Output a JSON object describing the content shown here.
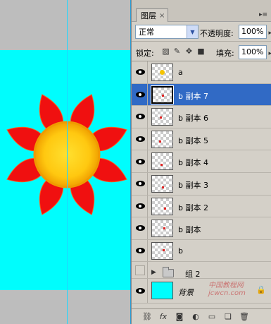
{
  "panel": {
    "tab_label": "图层",
    "tab_close": "×",
    "menu_icon": "▸≡"
  },
  "blend": {
    "mode": "正常",
    "opacity_label": "不透明度:",
    "opacity_value": "100%"
  },
  "lock": {
    "label": "锁定:",
    "fill_label": "填充:",
    "fill_value": "100%",
    "icons": [
      "lock-transparency-icon",
      "lock-pixels-icon",
      "lock-position-icon",
      "lock-all-icon"
    ]
  },
  "layers": [
    {
      "name": "a",
      "visible": true,
      "selected": false,
      "thumb": "sun"
    },
    {
      "name": "b 副本 7",
      "visible": true,
      "selected": true,
      "thumb": "petal"
    },
    {
      "name": "b 副本 6",
      "visible": true,
      "selected": false,
      "thumb": "petal"
    },
    {
      "name": "b 副本 5",
      "visible": true,
      "selected": false,
      "thumb": "petal"
    },
    {
      "name": "b 副本 4",
      "visible": true,
      "selected": false,
      "thumb": "petal"
    },
    {
      "name": "b 副本 3",
      "visible": true,
      "selected": false,
      "thumb": "petal"
    },
    {
      "name": "b 副本 2",
      "visible": true,
      "selected": false,
      "thumb": "petal"
    },
    {
      "name": "b 副本",
      "visible": true,
      "selected": false,
      "thumb": "petal"
    },
    {
      "name": "b",
      "visible": true,
      "selected": false,
      "thumb": "petal"
    }
  ],
  "group": {
    "name": "组 2",
    "visible": false
  },
  "background_layer": {
    "name": "背景",
    "visible": true,
    "color": "#00fdfd"
  },
  "footer_icons": [
    "link-icon",
    "fx-icon",
    "mask-icon",
    "adjustment-icon",
    "folder-icon",
    "new-layer-icon",
    "trash-icon"
  ],
  "colors": {
    "canvas_bg": "#00fdfd",
    "petal": "#f01010",
    "sun_center": "#ffd21a",
    "sun_edge": "#f2a000",
    "selection": "#316ac5"
  },
  "watermark": "中国教程网 jcwcn.com"
}
